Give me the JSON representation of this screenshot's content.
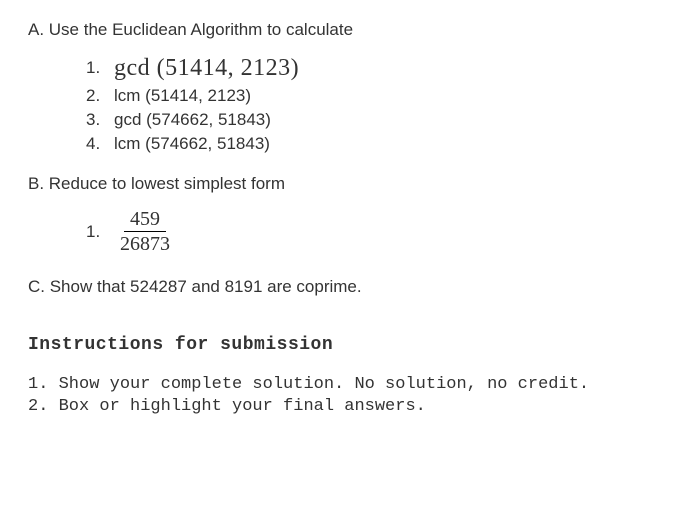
{
  "sectionA": {
    "header": "A. Use the Euclidean Algorithm to calculate",
    "items": [
      {
        "num": "1.",
        "text": "gcd (51414, 2123)"
      },
      {
        "num": "2.",
        "text": "lcm (51414, 2123)"
      },
      {
        "num": "3.",
        "text": "gcd (574662, 51843)"
      },
      {
        "num": "4.",
        "text": "lcm (574662, 51843)"
      }
    ]
  },
  "sectionB": {
    "header": "B. Reduce to lowest simplest form",
    "item": {
      "num": "1.",
      "numerator": "459",
      "denominator": "26873"
    }
  },
  "sectionC": {
    "header": "C. Show that 524287 and 8191 are coprime."
  },
  "instructions": {
    "header": "Instructions for submission",
    "items": [
      "1. Show your complete solution. No solution, no credit.",
      "2. Box or highlight your final answers."
    ]
  }
}
